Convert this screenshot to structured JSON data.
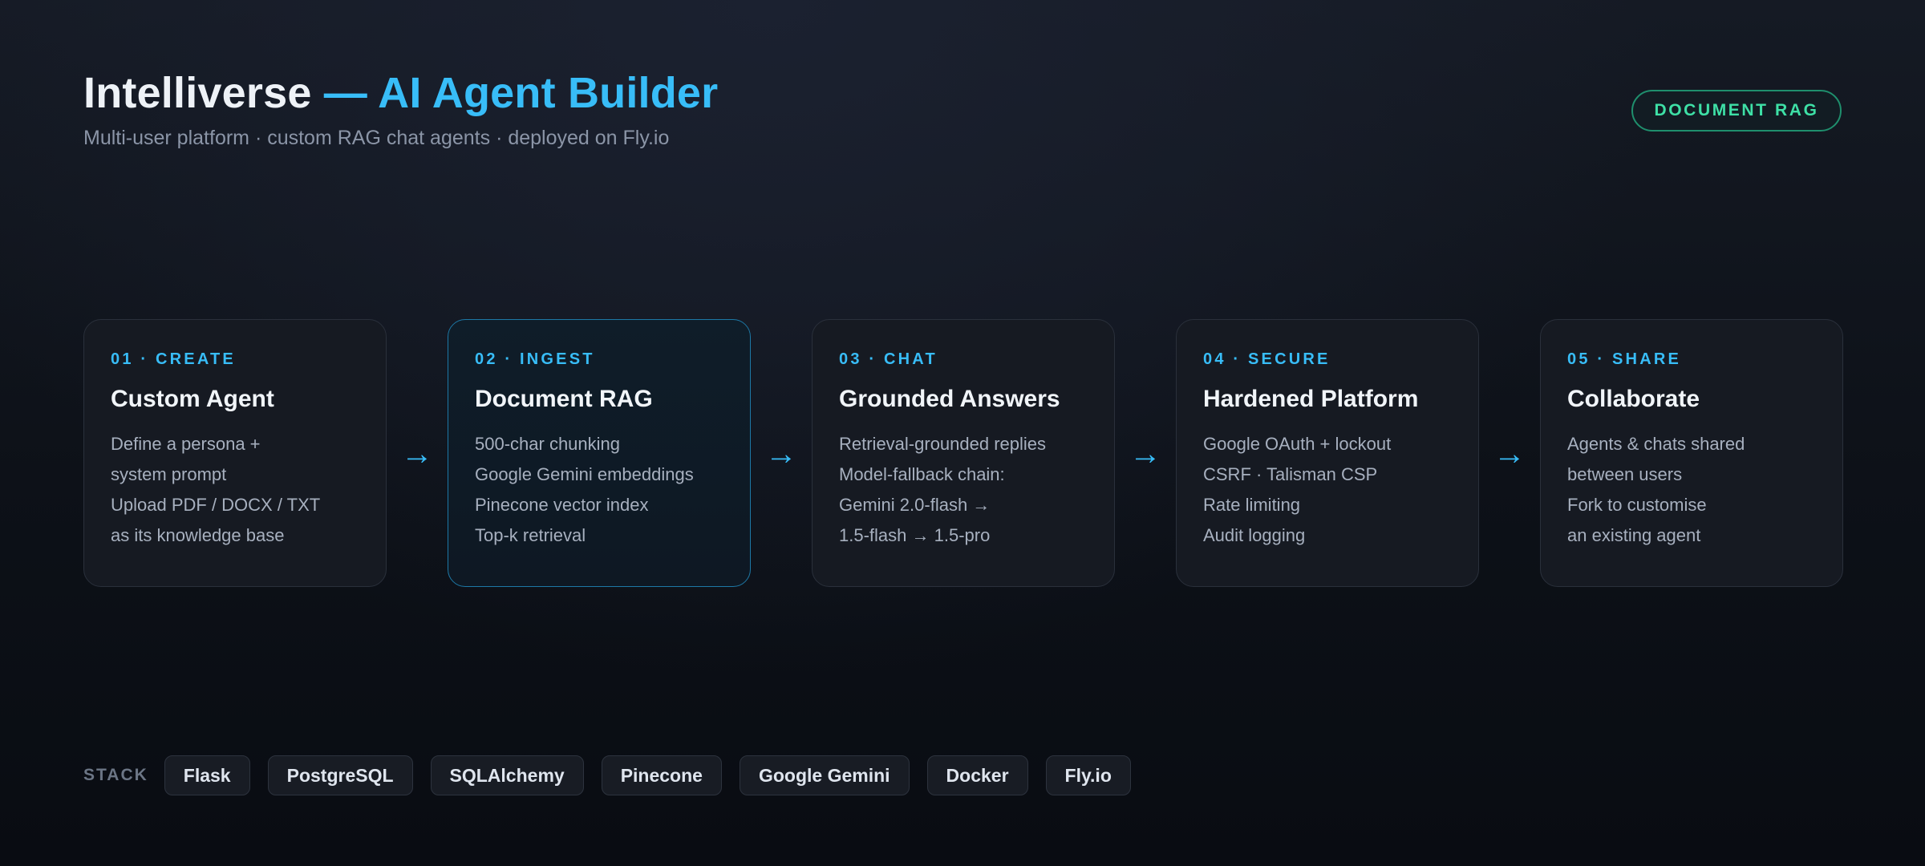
{
  "header": {
    "title_main": "Intelliverse",
    "title_accent": "— AI Agent Builder",
    "subtitle": "Multi-user platform · custom RAG chat agents · deployed on Fly.io"
  },
  "badge": "DOCUMENT RAG",
  "arrow_glyph": "→",
  "cards": [
    {
      "step": "01 · CREATE",
      "title": "Custom Agent",
      "lines": [
        "Define a persona +",
        "system prompt",
        "Upload PDF / DOCX / TXT",
        "as its knowledge base"
      ]
    },
    {
      "step": "02 · INGEST",
      "title": "Document RAG",
      "lines": [
        "500-char chunking",
        "Google Gemini embeddings",
        "Pinecone vector index",
        "Top-k retrieval"
      ]
    },
    {
      "step": "03 · CHAT",
      "title": "Grounded Answers",
      "lines": [
        "Retrieval-grounded replies",
        "Model-fallback chain:",
        "Gemini 2.0-flash →",
        "1.5-flash → 1.5-pro"
      ]
    },
    {
      "step": "04 · SECURE",
      "title": "Hardened Platform",
      "lines": [
        "Google OAuth + lockout",
        "CSRF · Talisman CSP",
        "Rate limiting",
        "Audit logging"
      ]
    },
    {
      "step": "05 · SHARE",
      "title": "Collaborate",
      "lines": [
        "Agents & chats shared",
        "between users",
        "Fork to customise",
        "an existing agent"
      ]
    }
  ],
  "stack": {
    "label": "STACK",
    "items": [
      "Flask",
      "PostgreSQL",
      "SQLAlchemy",
      "Pinecone",
      "Google Gemini",
      "Docker",
      "Fly.io"
    ]
  },
  "colors": {
    "accent": "#38bdf8",
    "badge": "#3ee0a6",
    "active_border": "#1d78a6",
    "background": "#0d1118"
  }
}
